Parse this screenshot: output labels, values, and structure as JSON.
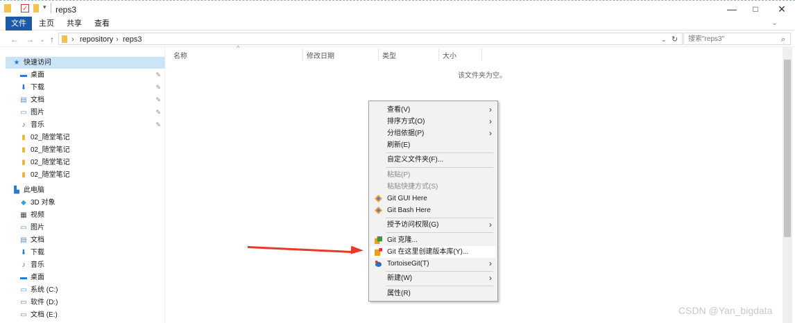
{
  "window": {
    "title": "reps3",
    "controls": {
      "minimize": "—",
      "maximize": "□",
      "close": "✕"
    }
  },
  "ribbon": {
    "tabs": [
      "文件",
      "主页",
      "共享",
      "查看"
    ]
  },
  "address": {
    "crumbs": [
      "repository",
      "reps3"
    ],
    "search_placeholder": "搜索\"reps3\""
  },
  "navpane": {
    "quick_access": "快速访问",
    "quick_items": [
      {
        "label": "桌面",
        "icon": "desktop-icon",
        "pinned": true
      },
      {
        "label": "下载",
        "icon": "download-icon",
        "pinned": true
      },
      {
        "label": "文档",
        "icon": "document-icon",
        "pinned": true
      },
      {
        "label": "图片",
        "icon": "picture-icon",
        "pinned": true
      },
      {
        "label": "音乐",
        "icon": "music-icon",
        "pinned": true
      },
      {
        "label": "02_随堂笔记",
        "icon": "folder-icon",
        "pinned": false
      },
      {
        "label": "02_随堂笔记",
        "icon": "folder-icon",
        "pinned": false
      },
      {
        "label": "02_随堂笔记",
        "icon": "folder-icon",
        "pinned": false
      },
      {
        "label": "02_随堂笔记",
        "icon": "folder-icon",
        "pinned": false
      }
    ],
    "this_pc": "此电脑",
    "pc_items": [
      {
        "label": "3D 对象",
        "icon": "3d-object-icon"
      },
      {
        "label": "视频",
        "icon": "video-icon"
      },
      {
        "label": "图片",
        "icon": "picture-icon"
      },
      {
        "label": "文档",
        "icon": "document-icon"
      },
      {
        "label": "下载",
        "icon": "download-icon"
      },
      {
        "label": "音乐",
        "icon": "music-icon"
      },
      {
        "label": "桌面",
        "icon": "desktop-icon"
      },
      {
        "label": "系统 (C:)",
        "icon": "drive-icon"
      },
      {
        "label": "软件 (D:)",
        "icon": "drive-icon"
      },
      {
        "label": "文档 (E:)",
        "icon": "drive-icon"
      }
    ]
  },
  "columns": [
    "名称",
    "修改日期",
    "类型",
    "大小"
  ],
  "empty_message": "该文件夹为空。",
  "context_menu": {
    "group1": [
      {
        "label": "查看(V)",
        "submenu": true
      },
      {
        "label": "排序方式(O)",
        "submenu": true
      },
      {
        "label": "分组依据(P)",
        "submenu": true
      },
      {
        "label": "刷新(E)",
        "submenu": false
      }
    ],
    "group2": [
      {
        "label": "自定义文件夹(F)...",
        "submenu": false
      }
    ],
    "group3": [
      {
        "label": "粘贴(P)",
        "disabled": true
      },
      {
        "label": "粘贴快捷方式(S)",
        "disabled": true
      },
      {
        "label": "Git GUI Here",
        "icon": "git-icon"
      },
      {
        "label": "Git Bash Here",
        "icon": "git-icon"
      }
    ],
    "group4": [
      {
        "label": "授予访问权限(G)",
        "submenu": true
      }
    ],
    "group5": [
      {
        "label": "Git 克隆...",
        "icon": "tortoisegit-clone-icon"
      },
      {
        "label": "Git 在这里创建版本库(Y)...",
        "icon": "tortoisegit-create-icon"
      },
      {
        "label": "TortoiseGit(T)",
        "icon": "tortoisegit-icon",
        "submenu": true
      }
    ],
    "group6": [
      {
        "label": "新建(W)",
        "submenu": true
      }
    ],
    "group7": [
      {
        "label": "属性(R)",
        "submenu": false
      }
    ]
  },
  "watermark": "CSDN @Yan_bigdata",
  "colors": {
    "accent": "#1a5aa8",
    "arrow": "#e53a2a",
    "selection": "#cce4f7"
  }
}
